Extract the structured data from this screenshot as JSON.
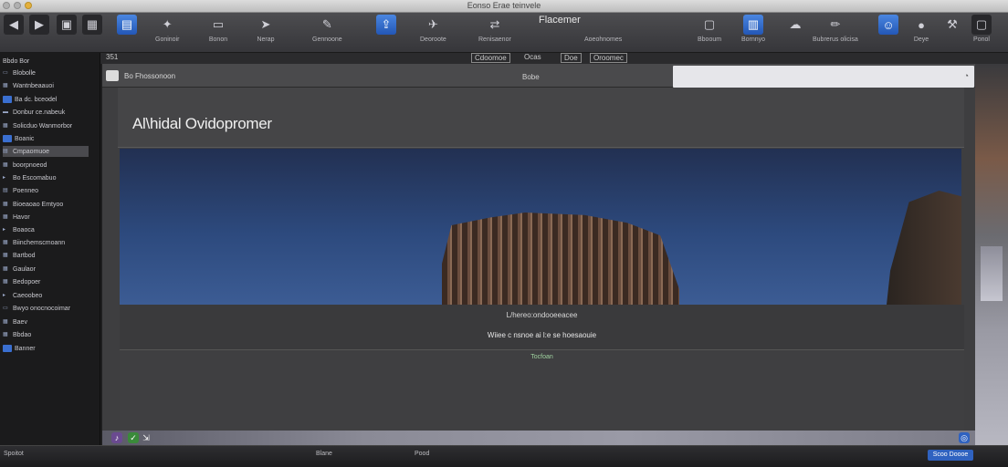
{
  "titlebar": {
    "title": "Eonso Erae teinvele"
  },
  "toolbar": {
    "items": [
      {
        "label": "",
        "icon": "back-icon"
      },
      {
        "label": "",
        "icon": "forward-icon"
      },
      {
        "label": "",
        "icon": "sidebar-icon"
      },
      {
        "label": "",
        "icon": "grid-icon"
      },
      {
        "label": "",
        "icon": "calendar-icon"
      },
      {
        "label": "Goninoir",
        "icon": "tag-icon"
      },
      {
        "label": "Bonon",
        "icon": "document-icon"
      },
      {
        "label": "Nerap",
        "icon": "cursor-icon"
      },
      {
        "label": "Gennoone",
        "icon": "pen-icon"
      },
      {
        "label": "",
        "icon": "share-icon"
      },
      {
        "label": "Deoroote",
        "icon": "bird-icon"
      },
      {
        "label": "Renisaenor",
        "icon": "arrows-icon"
      },
      {
        "label": "Flacemer",
        "icon": "title-icon"
      },
      {
        "label": "Aoeohnomes",
        "icon": "title-sub-icon"
      },
      {
        "label": "Bbooum",
        "icon": "monitor-icon"
      },
      {
        "label": "Bornnyo",
        "icon": "panels-icon"
      },
      {
        "label": "",
        "icon": "cloud-icon"
      },
      {
        "label": "Bubrerus olicisa",
        "icon": "pencil-icon"
      },
      {
        "label": "",
        "icon": "finder-icon"
      },
      {
        "label": "Deye",
        "icon": "circle-icon"
      },
      {
        "label": "",
        "icon": "hammer-icon"
      },
      {
        "label": "Ponol",
        "icon": "window-icon"
      }
    ]
  },
  "pathbar": {
    "segments": [
      "351",
      "Cdoomoe",
      "Ocas",
      "Doe",
      "Oroomec"
    ]
  },
  "sidebar": {
    "items": [
      {
        "label": "Bbdo Bor"
      },
      {
        "label": "Blobolle"
      },
      {
        "label": "Wantnbeaauoi"
      },
      {
        "label": "Ba dc. bceodel"
      },
      {
        "label": "Donbur ce.nabeuk"
      },
      {
        "label": "Solicduo Wanmorbor"
      },
      {
        "label": "Boanic"
      },
      {
        "label": "Cmpaomuoe"
      },
      {
        "label": "boorpnoeod"
      },
      {
        "label": "Bo Escomabuo"
      },
      {
        "label": "Poenneo"
      },
      {
        "label": "Bioeaoao Emtyoo"
      },
      {
        "label": "Havor"
      },
      {
        "label": "Boaoca"
      },
      {
        "label": "Biinchemscmoann"
      },
      {
        "label": "Bartbod"
      },
      {
        "label": "Gaulaor"
      },
      {
        "label": "Bedopoer"
      },
      {
        "label": "Caeoobeo"
      },
      {
        "label": "Bwyo onocnocoimar"
      },
      {
        "label": "Baev"
      },
      {
        "label": "Bbdao"
      },
      {
        "label": "Banner"
      }
    ]
  },
  "main": {
    "crumb": "Bo Fhossonoon",
    "center": "Bobe",
    "heading": "Al\\hidal Ovidopromer",
    "caption_top": "L/hereo:ondooeeacee",
    "caption_bottom": "Wiiee c nsnoe ai l:e se hoesaouie",
    "content_text": "Tocfoan"
  },
  "dock": {
    "items": [
      "music-icon",
      "app-icon",
      "arrow-icon",
      "blue-icon"
    ]
  },
  "statusbar": {
    "left": "Spoitot",
    "items": [
      "Blane",
      "Pood"
    ],
    "button": "Scoo Doooe"
  },
  "colors": {
    "accent": "#2f62c0",
    "chrome": "#3e3e40"
  }
}
